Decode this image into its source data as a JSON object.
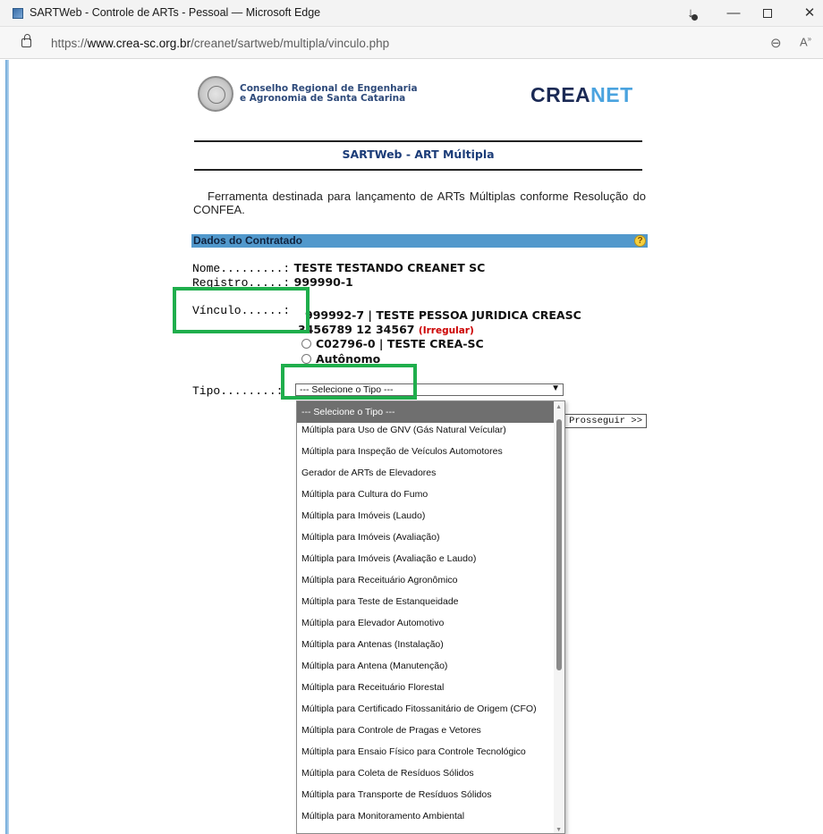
{
  "window": {
    "title": "SARTWeb - Controle de ARTs - Pessoal — Microsoft Edge",
    "url_prefix": "https://",
    "url_host": "www.crea-sc.org.br",
    "url_path": "/creanet/sartweb/multipla/vinculo.php"
  },
  "header": {
    "org_name": "Conselho Regional de Engenharia\ne Agronomia de Santa Catarina",
    "brand": "CREANET"
  },
  "page": {
    "section_title": "SARTWeb - ART Múltipla",
    "intro": "Ferramenta destinada para lançamento de ARTs Múltiplas conforme Resolução do CONFEA.",
    "contratado_header": "Dados do Contratado",
    "help_symbol": "?"
  },
  "contratado": {
    "nome_label": "Nome.........:",
    "nome_value": "TESTE TESTANDO CREANET SC",
    "registro_label": "Registro.....:",
    "registro_value": "999990-1",
    "vinculo_label": "Vínculo......:",
    "vinculo_option1_line1": "999992-7 | TESTE PESSOA JURIDICA CREASC",
    "vinculo_option1_line2": "3456789 12 34567",
    "vinculo_option1_status": "(Irregular)",
    "vinculo_option2": "C02796-0 | TESTE CREA-SC",
    "vinculo_option3": "Autônomo"
  },
  "tipo": {
    "label": "Tipo........:",
    "selected": "--- Selecione o Tipo ---",
    "proceed_button": "Prosseguir >>",
    "options": [
      "--- Selecione o Tipo ---",
      "Múltipla para Uso de GNV (Gás Natural Veícular)",
      "Múltipla para Inspeção de Veículos Automotores",
      "Gerador de ARTs de Elevadores",
      "Múltipla para Cultura do Fumo",
      "Múltipla para Imóveis (Laudo)",
      "Múltipla para Imóveis (Avaliação)",
      "Múltipla para Imóveis (Avaliação e Laudo)",
      "Múltipla para Receituário Agronômico",
      "Múltipla para Teste de Estanqueidade",
      "Múltipla para Elevador Automotivo",
      "Múltipla para Antenas (Instalação)",
      "Múltipla para Antena (Manutenção)",
      "Múltipla para Receituário Florestal",
      "Múltipla para Certificado Fitossanitário de Origem (CFO)",
      "Múltipla para Controle de Pragas e Vetores",
      "Múltipla para Ensaio Físico para Controle Tecnológico",
      "Múltipla para Coleta de Resíduos Sólidos",
      "Múltipla para Transporte de Resíduos Sólidos",
      "Múltipla para Monitoramento Ambiental"
    ]
  },
  "colors": {
    "section_bar": "#5198cc",
    "highlight": "#1fae4c",
    "irregular": "#cc0000",
    "dropdown_selected": "#6f6f6f"
  }
}
